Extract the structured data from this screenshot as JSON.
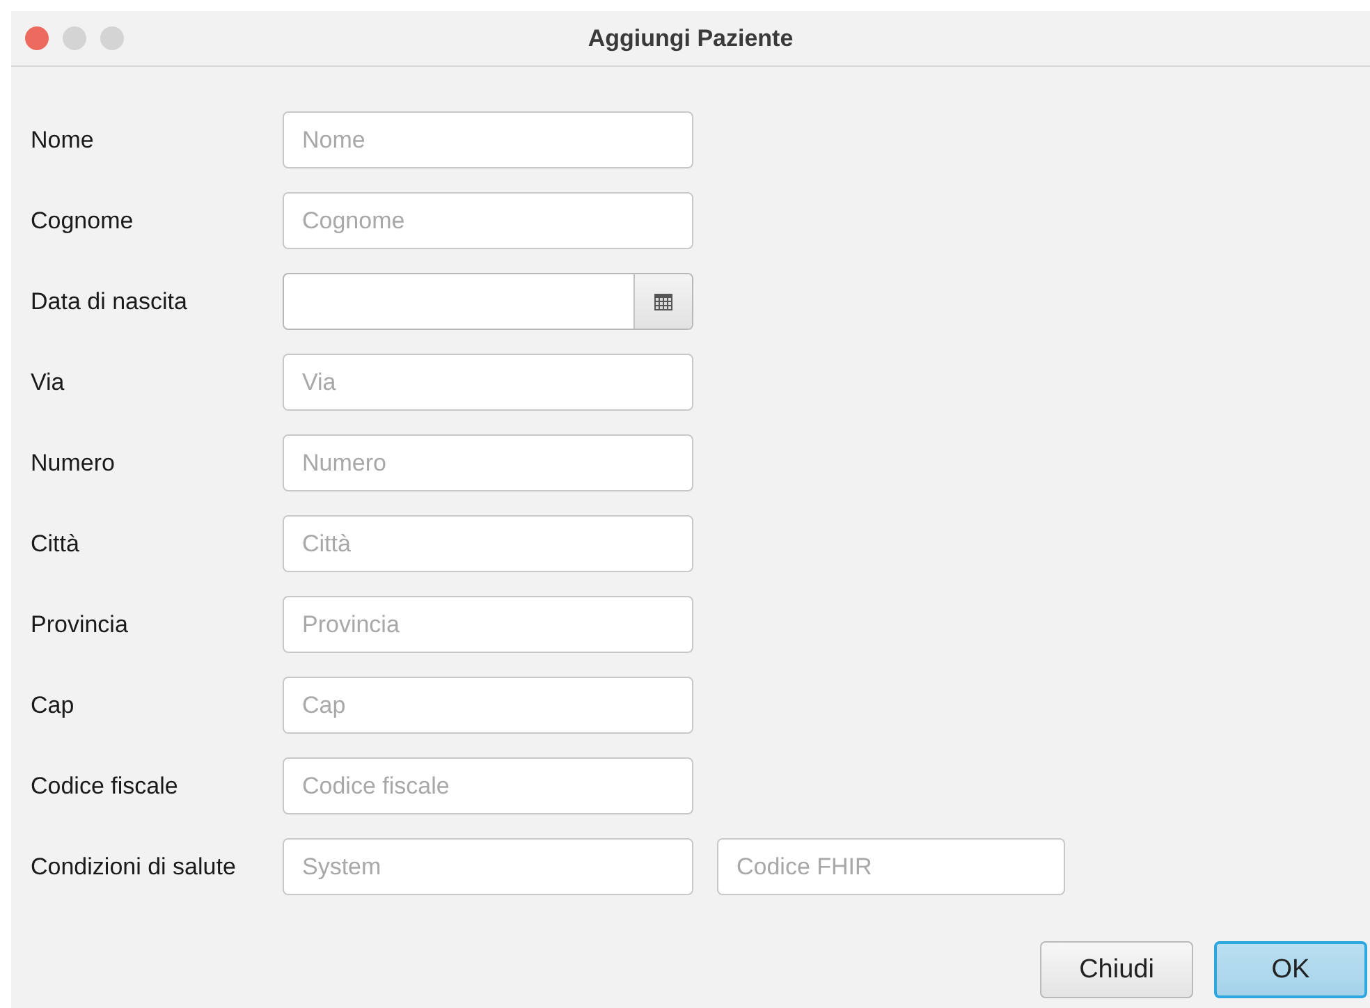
{
  "window": {
    "title": "Aggiungi Paziente",
    "controls": [
      {
        "color": "#ec6a5e"
      },
      {
        "color": "#d4d4d4"
      },
      {
        "color": "#d4d4d4"
      }
    ]
  },
  "form": [
    {
      "label": "Nome",
      "kind": "text",
      "placeholder": "Nome"
    },
    {
      "label": "Cognome",
      "kind": "text",
      "placeholder": "Cognome"
    },
    {
      "label": "Data di nascita",
      "kind": "date"
    },
    {
      "label": "Via",
      "kind": "text",
      "placeholder": "Via"
    },
    {
      "label": "Numero",
      "kind": "text",
      "placeholder": "Numero"
    },
    {
      "label": "Città",
      "kind": "text",
      "placeholder": "Città"
    },
    {
      "label": "Provincia",
      "kind": "text",
      "placeholder": "Provincia"
    },
    {
      "label": "Cap",
      "kind": "text",
      "placeholder": "Cap"
    },
    {
      "label": "Codice fiscale",
      "kind": "text",
      "placeholder": "Codice fiscale"
    },
    {
      "label": "Condizioni di salute",
      "kind": "pair",
      "placeholder": "System",
      "placeholder_2": "Codice FHIR"
    }
  ],
  "buttons": [
    {
      "label": "Chiudi",
      "default": false
    },
    {
      "label": "OK",
      "default": true
    }
  ]
}
